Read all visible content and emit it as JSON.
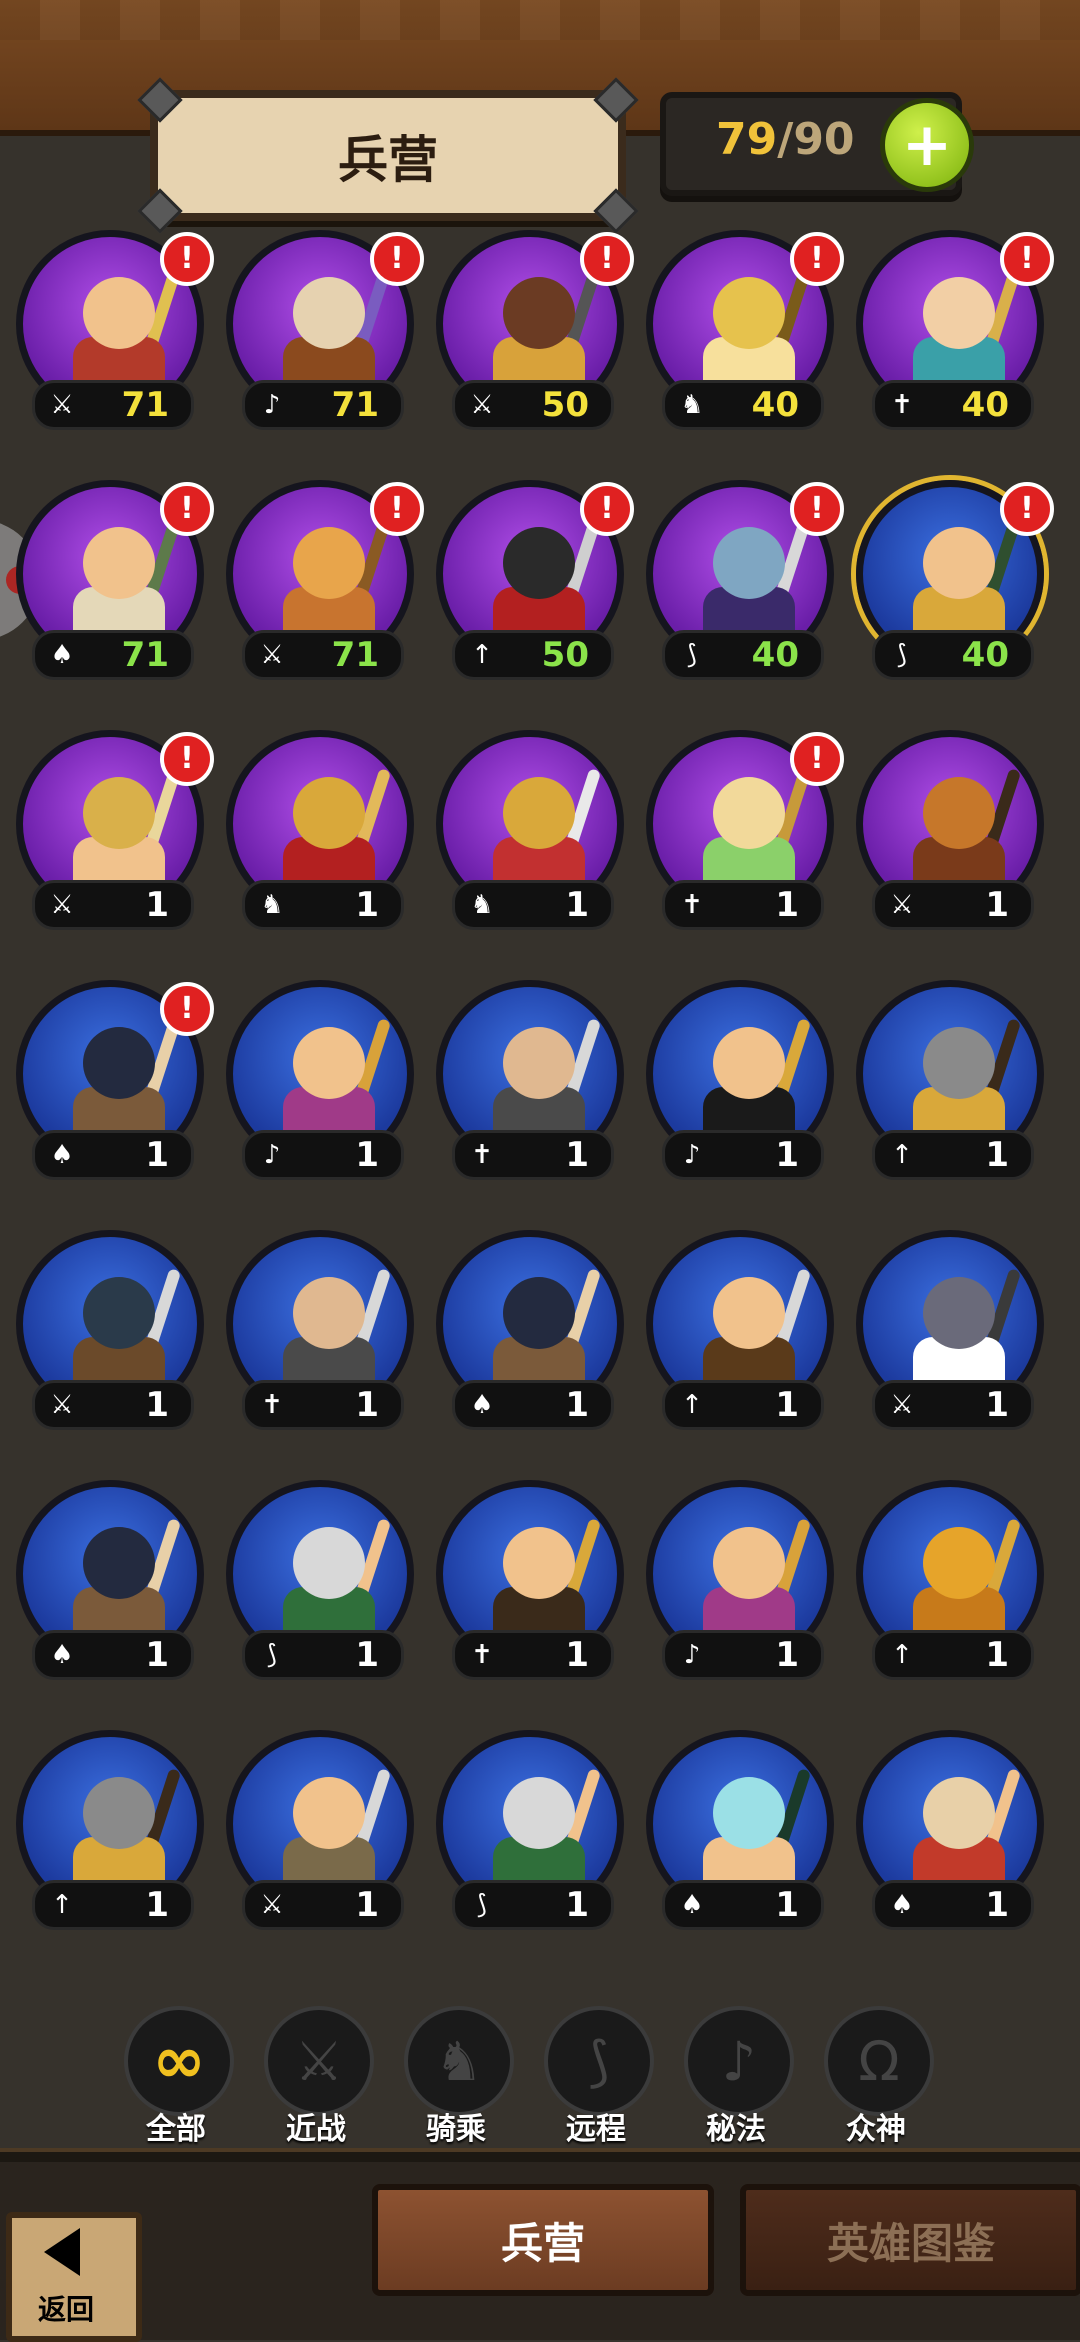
{
  "header": {
    "title": "兵营",
    "count_current": "79",
    "count_sep": "/",
    "count_max": "90",
    "plus_label": "+"
  },
  "units": [
    {
      "frame": "purple",
      "value": "71",
      "color": "yellow",
      "icon": "sword",
      "icon_glyph": "⚔",
      "alert": true,
      "palette": [
        "#f1c28c",
        "#b33a2a",
        "#e0c050"
      ]
    },
    {
      "frame": "purple",
      "value": "71",
      "color": "yellow",
      "icon": "mystic",
      "icon_glyph": "♪",
      "alert": true,
      "palette": [
        "#e6d2b0",
        "#8b4a1e",
        "#7a5cc0"
      ]
    },
    {
      "frame": "purple",
      "value": "50",
      "color": "yellow",
      "icon": "sword",
      "icon_glyph": "⚔",
      "alert": true,
      "palette": [
        "#6b3b23",
        "#d8a23a",
        "#555"
      ]
    },
    {
      "frame": "purple",
      "value": "40",
      "color": "yellow",
      "icon": "mount",
      "icon_glyph": "♞",
      "alert": true,
      "palette": [
        "#e6c24d",
        "#f7e09c",
        "#7a5b1a"
      ]
    },
    {
      "frame": "purple",
      "value": "40",
      "color": "yellow",
      "icon": "god",
      "icon_glyph": "✝",
      "alert": true,
      "palette": [
        "#f2cfa5",
        "#3aa0a8",
        "#d9b04a"
      ]
    },
    {
      "frame": "purple",
      "value": "71",
      "color": "green",
      "icon": "mount-alt",
      "icon_glyph": "♠",
      "alert": true,
      "palette": [
        "#f1c28c",
        "#e4d8b8",
        "#5d7a4a"
      ]
    },
    {
      "frame": "purple",
      "value": "71",
      "color": "green",
      "icon": "sword",
      "icon_glyph": "⚔",
      "alert": true,
      "palette": [
        "#e8a54b",
        "#c8742f",
        "#8a5a23"
      ]
    },
    {
      "frame": "purple",
      "value": "50",
      "color": "green",
      "icon": "spear",
      "icon_glyph": "↑",
      "alert": true,
      "palette": [
        "#2a2a2a",
        "#b32020",
        "#cfcfcf"
      ]
    },
    {
      "frame": "purple",
      "value": "40",
      "color": "green",
      "icon": "bow",
      "icon_glyph": "⟆",
      "alert": true,
      "palette": [
        "#7fa6c2",
        "#3a2a6a",
        "#d8d8d8"
      ]
    },
    {
      "frame": "blue",
      "gold": true,
      "value": "40",
      "color": "green",
      "icon": "bow",
      "icon_glyph": "⟆",
      "alert": true,
      "palette": [
        "#f1c28c",
        "#d9a83a",
        "#2f4f2f"
      ]
    },
    {
      "frame": "purple",
      "value": "1",
      "color": "white",
      "icon": "sword",
      "icon_glyph": "⚔",
      "alert": true,
      "palette": [
        "#d9b04a",
        "#f1c28c",
        "#e9d79b"
      ]
    },
    {
      "frame": "purple",
      "value": "1",
      "color": "white",
      "icon": "mount",
      "icon_glyph": "♞",
      "alert": false,
      "palette": [
        "#d9a83a",
        "#b32020",
        "#e2b95a"
      ]
    },
    {
      "frame": "purple",
      "value": "1",
      "color": "white",
      "icon": "mount",
      "icon_glyph": "♞",
      "alert": false,
      "palette": [
        "#d9a83a",
        "#c23030",
        "#e9e9e9"
      ]
    },
    {
      "frame": "purple",
      "value": "1",
      "color": "white",
      "icon": "god",
      "icon_glyph": "✝",
      "alert": true,
      "palette": [
        "#f2d99a",
        "#8bd06a",
        "#c79a3a"
      ]
    },
    {
      "frame": "purple",
      "value": "1",
      "color": "white",
      "icon": "sword",
      "icon_glyph": "⚔",
      "alert": false,
      "palette": [
        "#c6772a",
        "#7a3a1a",
        "#3a2a1a"
      ]
    },
    {
      "frame": "blue",
      "value": "1",
      "color": "white",
      "icon": "mount-alt",
      "icon_glyph": "♠",
      "alert": true,
      "palette": [
        "#232a3f",
        "#7b5a3a",
        "#e8d0a8"
      ]
    },
    {
      "frame": "blue",
      "value": "1",
      "color": "white",
      "icon": "mystic",
      "icon_glyph": "♪",
      "alert": false,
      "palette": [
        "#f1c28c",
        "#a03a88",
        "#d8a23a"
      ]
    },
    {
      "frame": "blue",
      "value": "1",
      "color": "white",
      "icon": "god",
      "icon_glyph": "✝",
      "alert": false,
      "palette": [
        "#e0b890",
        "#4a4a4a",
        "#d8d8d8"
      ]
    },
    {
      "frame": "blue",
      "value": "1",
      "color": "white",
      "icon": "mystic",
      "icon_glyph": "♪",
      "alert": false,
      "palette": [
        "#f1c28c",
        "#1a1a1a",
        "#d9a83a"
      ]
    },
    {
      "frame": "blue",
      "value": "1",
      "color": "white",
      "icon": "spear",
      "icon_glyph": "↑",
      "alert": false,
      "palette": [
        "#8a8a8a",
        "#d9a83a",
        "#3a2a1a"
      ]
    },
    {
      "frame": "blue",
      "value": "1",
      "color": "white",
      "icon": "sword",
      "icon_glyph": "⚔",
      "alert": false,
      "palette": [
        "#2a3a4a",
        "#6b4a2a",
        "#d8d8d8"
      ]
    },
    {
      "frame": "blue",
      "value": "1",
      "color": "white",
      "icon": "god",
      "icon_glyph": "✝",
      "alert": false,
      "palette": [
        "#e0b890",
        "#4a4a4a",
        "#d8d8d8"
      ]
    },
    {
      "frame": "blue",
      "value": "1",
      "color": "white",
      "icon": "mount-alt",
      "icon_glyph": "♠",
      "alert": false,
      "palette": [
        "#232a3f",
        "#7b5a3a",
        "#e8d0a8"
      ]
    },
    {
      "frame": "blue",
      "value": "1",
      "color": "white",
      "icon": "spear",
      "icon_glyph": "↑",
      "alert": false,
      "palette": [
        "#f1c28c",
        "#5a3a1a",
        "#d8d8d8"
      ]
    },
    {
      "frame": "blue",
      "value": "1",
      "color": "white",
      "icon": "sword",
      "icon_glyph": "⚔",
      "alert": false,
      "palette": [
        "#6a6a7a",
        "#ffffff",
        "#3a3a3a"
      ]
    },
    {
      "frame": "blue",
      "value": "1",
      "color": "white",
      "icon": "mount-alt",
      "icon_glyph": "♠",
      "alert": false,
      "palette": [
        "#232a3f",
        "#7b5a3a",
        "#e8d0a8"
      ]
    },
    {
      "frame": "blue",
      "value": "1",
      "color": "white",
      "icon": "bow",
      "icon_glyph": "⟆",
      "alert": false,
      "palette": [
        "#d8d8d8",
        "#2f6f3a",
        "#f1c28c"
      ]
    },
    {
      "frame": "blue",
      "value": "1",
      "color": "white",
      "icon": "god",
      "icon_glyph": "✝",
      "alert": false,
      "palette": [
        "#f1c28c",
        "#3a2a1a",
        "#d9a83a"
      ]
    },
    {
      "frame": "blue",
      "value": "1",
      "color": "white",
      "icon": "mystic",
      "icon_glyph": "♪",
      "alert": false,
      "palette": [
        "#f1c28c",
        "#a03a88",
        "#d8a23a"
      ]
    },
    {
      "frame": "blue",
      "value": "1",
      "color": "white",
      "icon": "spear",
      "icon_glyph": "↑",
      "alert": false,
      "palette": [
        "#e6a42a",
        "#c77a1a",
        "#d9a83a"
      ]
    },
    {
      "frame": "blue",
      "value": "1",
      "color": "white",
      "icon": "spear",
      "icon_glyph": "↑",
      "alert": false,
      "palette": [
        "#8a8a8a",
        "#d9a83a",
        "#3a2a1a"
      ]
    },
    {
      "frame": "blue",
      "value": "1",
      "color": "white",
      "icon": "sword",
      "icon_glyph": "⚔",
      "alert": false,
      "palette": [
        "#f1c28c",
        "#7a6a4a",
        "#d8d8d8"
      ]
    },
    {
      "frame": "blue",
      "value": "1",
      "color": "white",
      "icon": "bow",
      "icon_glyph": "⟆",
      "alert": false,
      "palette": [
        "#d8d8d8",
        "#2f6f3a",
        "#f1c28c"
      ]
    },
    {
      "frame": "blue",
      "value": "1",
      "color": "white",
      "icon": "mount-alt",
      "icon_glyph": "♠",
      "alert": false,
      "palette": [
        "#9be0e6",
        "#f1c28c",
        "#1a3a2a"
      ]
    },
    {
      "frame": "blue",
      "value": "1",
      "color": "white",
      "icon": "mount-alt",
      "icon_glyph": "♠",
      "alert": false,
      "palette": [
        "#e8d0a8",
        "#c23a2a",
        "#f1c28c"
      ]
    }
  ],
  "filters": [
    {
      "label": "全部",
      "glyph": "∞",
      "active": true,
      "icon": "infinity-icon"
    },
    {
      "label": "近战",
      "glyph": "⚔",
      "active": false,
      "icon": "sword-icon"
    },
    {
      "label": "骑乘",
      "glyph": "♞",
      "active": false,
      "icon": "horse-icon"
    },
    {
      "label": "远程",
      "glyph": "⟆",
      "active": false,
      "icon": "bow-icon"
    },
    {
      "label": "秘法",
      "glyph": "♪",
      "active": false,
      "icon": "mystic-icon"
    },
    {
      "label": "众神",
      "glyph": "Ω",
      "active": false,
      "icon": "omega-icon"
    }
  ],
  "bottom": {
    "back_label": "返回",
    "tab_barracks": "兵营",
    "tab_codex": "英雄图鉴"
  }
}
